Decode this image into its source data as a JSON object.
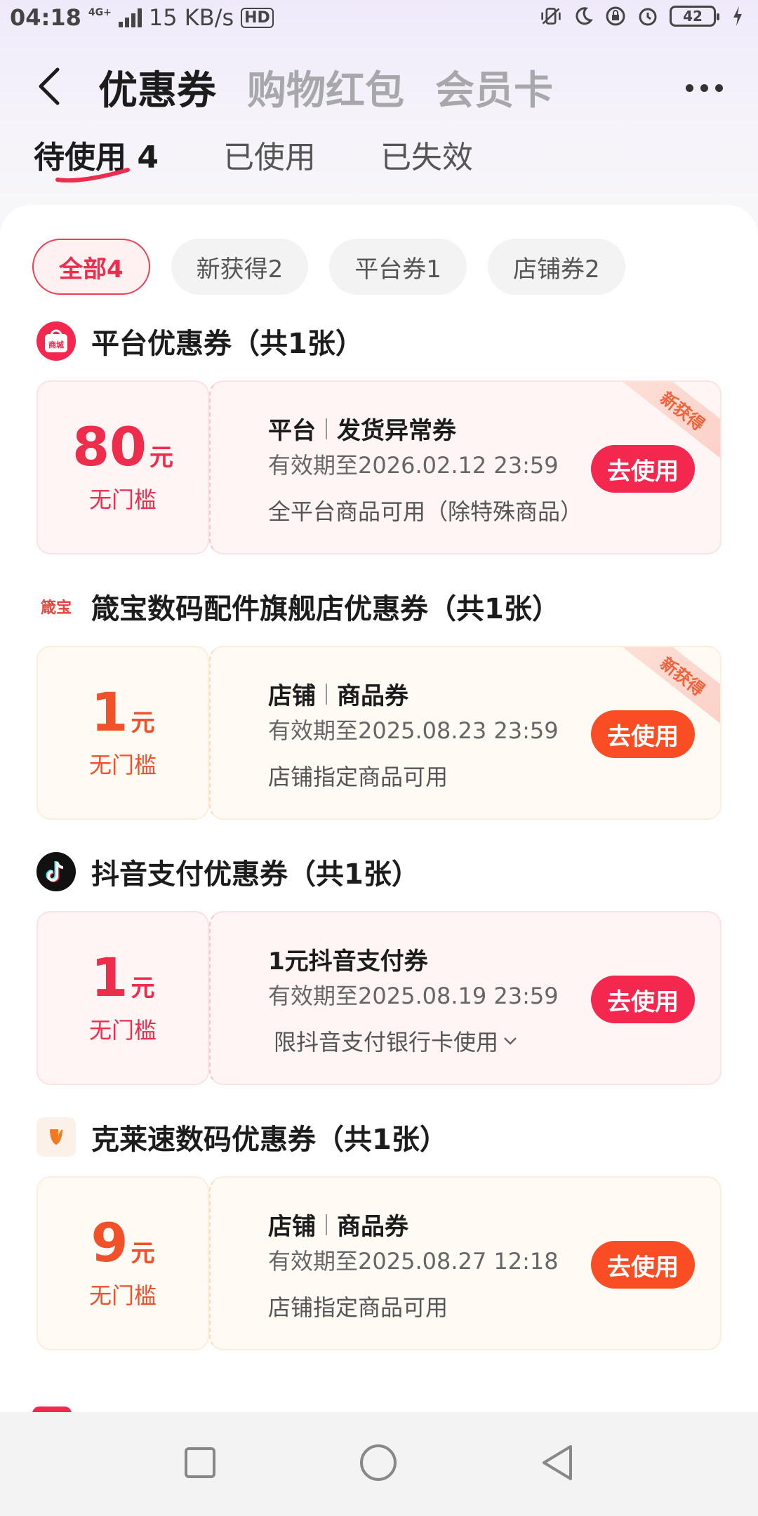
{
  "status_bar": {
    "time": "04:18",
    "network": "4G+",
    "speed": "15 KB/s",
    "hd": "HD",
    "battery": "42"
  },
  "header": {
    "tabs": [
      {
        "label": "优惠券",
        "active": true
      },
      {
        "label": "购物红包",
        "active": false
      },
      {
        "label": "会员卡",
        "active": false
      }
    ]
  },
  "sub_tabs": [
    {
      "label": "待使用 4",
      "active": true
    },
    {
      "label": "已使用",
      "active": false
    },
    {
      "label": "已失效",
      "active": false
    }
  ],
  "filters": [
    {
      "label": "全部4",
      "active": true
    },
    {
      "label": "新获得2",
      "active": false
    },
    {
      "label": "平台券1",
      "active": false
    },
    {
      "label": "店铺券2",
      "active": false
    }
  ],
  "sections": [
    {
      "title": "平台优惠券（共1张）",
      "logo_text": "商城",
      "logo_color": "#f4284e",
      "coupon": {
        "amount": "80",
        "unit": "元",
        "threshold": "无门槛",
        "type": "平台",
        "name": "发货异常券",
        "valid": "有效期至2026.02.12 23:59",
        "desc": "全平台商品可用（除特殊商品）",
        "button": "去使用",
        "badge": "新获得",
        "theme": "red"
      }
    },
    {
      "title": "箴宝数码配件旗舰店优惠券（共1张）",
      "logo_text": "箴宝",
      "logo_color": "#e8423a",
      "coupon": {
        "amount": "1",
        "unit": "元",
        "threshold": "无门槛",
        "type": "店铺",
        "name": "商品券",
        "valid": "有效期至2025.08.23 23:59",
        "desc": "店铺指定商品可用",
        "button": "去使用",
        "badge": "新获得",
        "theme": "orange"
      }
    },
    {
      "title": "抖音支付优惠券（共1张）",
      "logo_color": "#111111",
      "coupon": {
        "amount": "1",
        "unit": "元",
        "threshold": "无门槛",
        "name": "1元抖音支付券",
        "valid": "有效期至2025.08.19 23:59",
        "desc": "限抖音支付银行卡使用",
        "button": "去使用",
        "theme": "red"
      }
    },
    {
      "title": "克莱速数码优惠券（共1张）",
      "logo_color": "#f07a22",
      "coupon": {
        "amount": "9",
        "unit": "元",
        "threshold": "无门槛",
        "type": "店铺",
        "name": "商品券",
        "valid": "有效期至2025.08.27 12:18",
        "desc": "店铺指定商品可用",
        "button": "去使用",
        "theme": "orange"
      }
    }
  ]
}
